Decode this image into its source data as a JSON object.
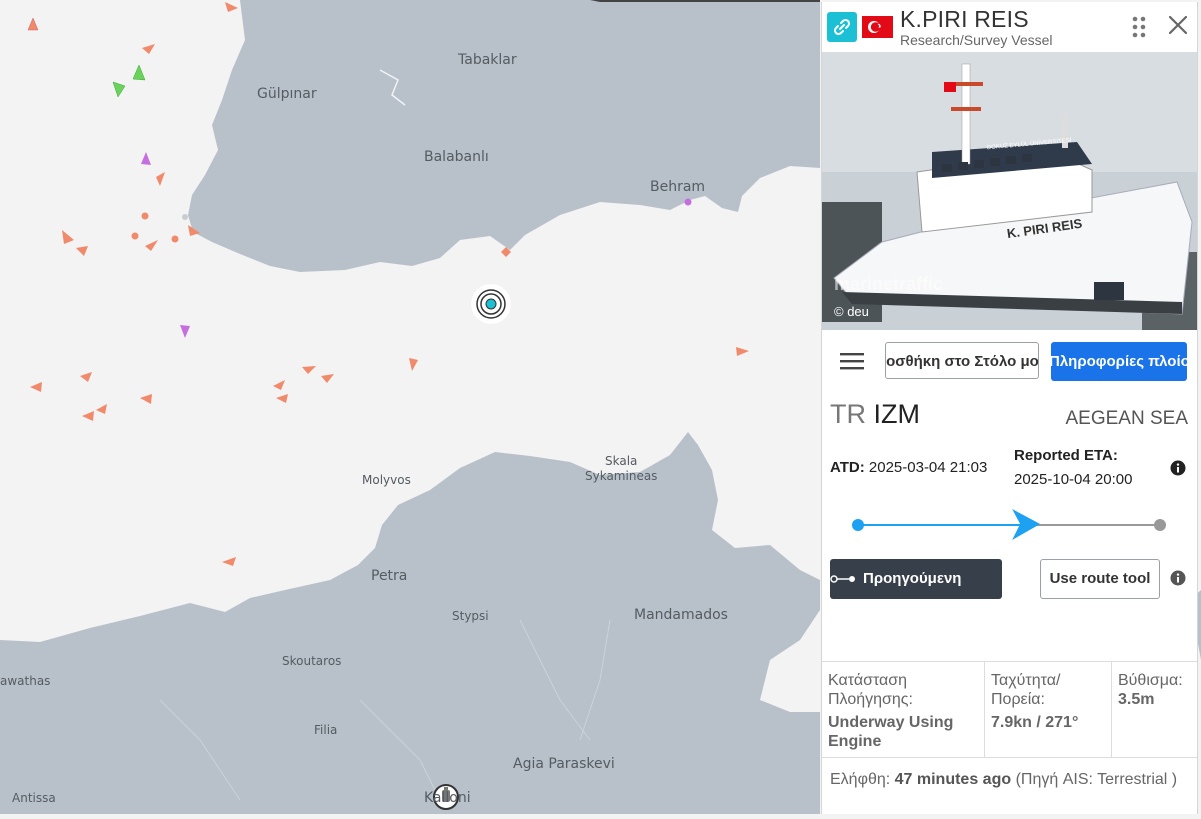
{
  "map": {
    "places": [
      {
        "name": "Tabaklar"
      },
      {
        "name": "Gülpınar"
      },
      {
        "name": "Balabanlı"
      },
      {
        "name": "Behram"
      },
      {
        "name": "Skala"
      },
      {
        "name": "Sykamineas"
      },
      {
        "name": "Molyvos"
      },
      {
        "name": "Petra"
      },
      {
        "name": "Stypsi"
      },
      {
        "name": "Mandamados"
      },
      {
        "name": "Skoutaros"
      },
      {
        "name": "Filia"
      },
      {
        "name": "Agia Paraskevi"
      },
      {
        "name": "Antissa"
      },
      {
        "name": "awathas"
      },
      {
        "name": "Kalloni"
      }
    ],
    "colors": {
      "sea": "#f3f3f3",
      "land": "#b8c1ca",
      "cargo_vessel": "#f1896b",
      "passenger_vessel": "#c66ee0",
      "tug_vessel": "#6bd35c"
    }
  },
  "panel": {
    "vessel_name": "K.PIRI REIS",
    "vessel_type": "Research/Survey Vessel",
    "flag": "Turkey",
    "icons": {
      "link": "link-icon",
      "drag": "drag-handle-icon",
      "close": "close-icon",
      "menu": "menu-icon",
      "info": "info-icon"
    },
    "photo": {
      "watermark": "marinetraffic",
      "credit": "© deu",
      "hull_name": "K. PIRI REIS",
      "bridge_text": "DOKUZ EYLÜL ÜNİVERSİTESİ"
    },
    "buttons": {
      "add_to_fleet": "Προσθήκη στο Στόλο μου",
      "vessel_info": "Πληροφορίες πλοίου",
      "past_track": "Προηγούμενη πορεία",
      "route_tool": "Use route tool"
    },
    "voyage": {
      "departure_country": "TR",
      "departure_port": "IZM",
      "destination": "AEGEAN SEA",
      "atd_label": "ATD:",
      "atd_value": "2025-03-04 21:03",
      "eta_label": "Reported ETA:",
      "eta_value": "2025-10-04 20:00",
      "progress": 0.57
    },
    "stats": {
      "nav_status_label": "Κατάσταση Πλοήγησης:",
      "nav_status_value": "Underway Using Engine",
      "speed_label": "Ταχύτητα/ Πορεία:",
      "speed_value": "7.9kn / 271°",
      "draught_label": "Βύθισμα:",
      "draught_value": "3.5m"
    },
    "received": {
      "label": "Ελήφθη:",
      "value": "47 minutes ago",
      "source": "(Πηγή AIS: Terrestrial )"
    }
  }
}
